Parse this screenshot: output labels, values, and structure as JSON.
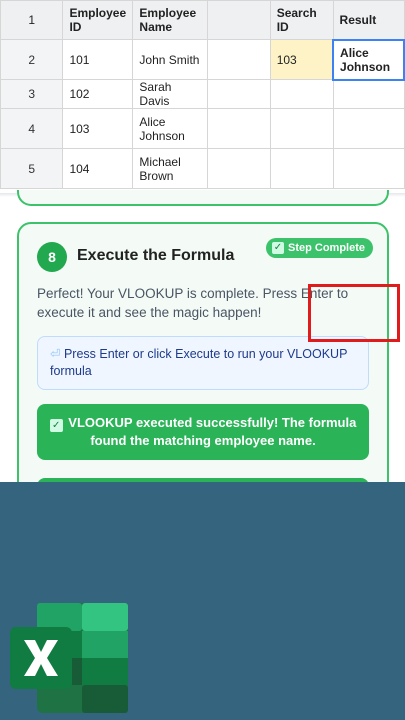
{
  "sheet": {
    "headers": [
      "Employee ID",
      "Employee Name",
      "",
      "Search ID",
      "Result"
    ],
    "rows": [
      {
        "num": "1"
      },
      {
        "num": "2",
        "cells": [
          "101",
          "John Smith",
          "",
          "103",
          "Alice Johnson"
        ]
      },
      {
        "num": "3",
        "cells": [
          "102",
          "Sarah Davis",
          "",
          "",
          ""
        ]
      },
      {
        "num": "4",
        "cells": [
          "103",
          "Alice Johnson",
          "",
          "",
          ""
        ]
      },
      {
        "num": "5",
        "cells": [
          "104",
          "Michael Brown",
          "",
          "",
          ""
        ]
      }
    ]
  },
  "step": {
    "number": "8",
    "title": "Execute the Formula",
    "badge": "Step Complete",
    "description": "Perfect! Your VLOOKUP is complete. Press Enter to execute it and see the magic happen!",
    "hint": "Press Enter or click Execute to run your VLOOKUP formula",
    "success": "VLOOKUP executed successfully! The formula found the matching employee name."
  },
  "icons": {
    "badge_icon": "check-box-icon",
    "hint_icon": "enter-key-icon",
    "success_icon": "check-box-icon",
    "logo": "excel-logo-icon"
  },
  "colors": {
    "accent_green": "#2bb358",
    "card_border": "#3cc26a",
    "highlight_yellow": "#fef3c7",
    "selection_blue": "#3b82f6",
    "annotation_red": "#e01b1b",
    "panel_blue": "#35647e"
  }
}
